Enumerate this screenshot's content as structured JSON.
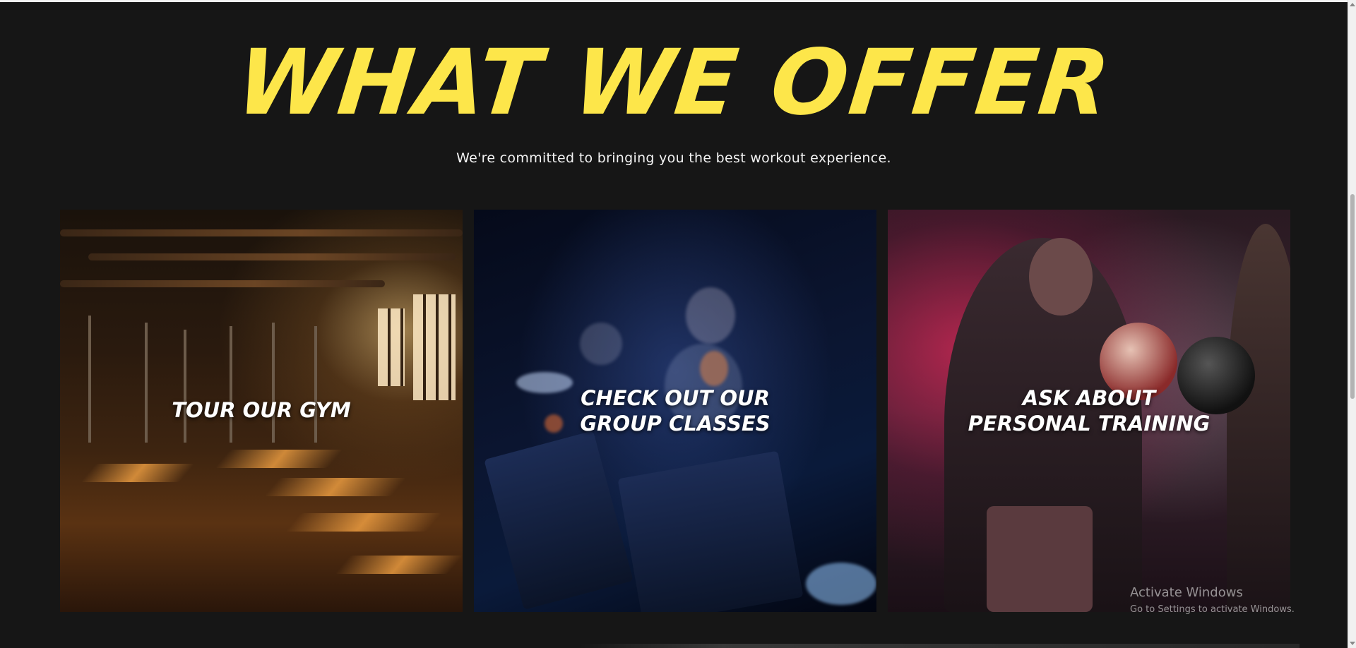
{
  "section": {
    "headline": "WHAT WE OFFER",
    "subtitle": "We're committed to bringing you the best workout experience."
  },
  "cards": [
    {
      "title": "TOUR OUR GYM",
      "image": "gym-interior"
    },
    {
      "title": "CHECK OUT OUR\nGROUP CLASSES",
      "image": "spin-class"
    },
    {
      "title": "ASK ABOUT\nPERSONAL TRAINING",
      "image": "boxing-training"
    }
  ],
  "system_watermark": {
    "title": "Activate Windows",
    "subtitle": "Go to Settings to activate Windows."
  },
  "colors": {
    "background": "#161616",
    "headline": "#fde64a",
    "text": "#ffffff"
  }
}
